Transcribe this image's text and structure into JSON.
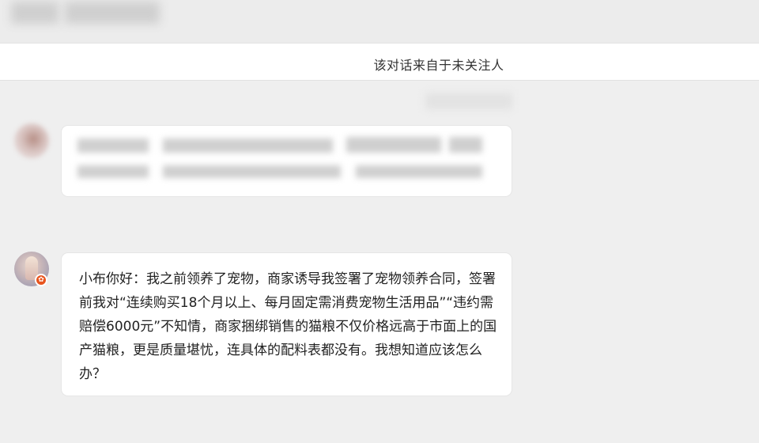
{
  "header": {
    "title_redacted": true
  },
  "notice": {
    "text": "该对话来自于未关注人"
  },
  "messages": [
    {
      "avatar_icon": "user-avatar-icon",
      "text_redacted": true
    },
    {
      "avatar_icon": "user-avatar-icon",
      "badge_icon": "verified-badge-icon",
      "badge_color": "#e8541e",
      "text": "小布你好：我之前领养了宠物，商家诱导我签署了宠物领养合同，签署前我对“连续购买18个月以上、每月固定需消费宠物生活用品”“违约需赔偿6000元”不知情，商家捆绑销售的猫粮不仅价格远高于市面上的国产猫粮，更是质量堪忧，连具体的配料表都没有。我想知道应该怎么办？"
    }
  ],
  "colors": {
    "background": "#efefef",
    "bubble": "#ffffff",
    "text": "#222222"
  }
}
